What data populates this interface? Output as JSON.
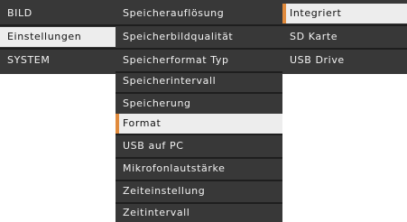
{
  "colors": {
    "panel_bg": "#383838",
    "separator": "#1e1e1e",
    "text": "#f2f2f2",
    "highlight_bg": "#ededed",
    "highlight_text": "#111111",
    "accent": "#e08a3c"
  },
  "main_menu": {
    "items": [
      {
        "label": "BILD"
      },
      {
        "label": "Einstellungen",
        "selected": true
      },
      {
        "label": "SYSTEM"
      }
    ]
  },
  "settings_menu": {
    "items": [
      {
        "label": "Speicherauflösung"
      },
      {
        "label": "Speicherbildqualität"
      },
      {
        "label": "Speicherformat Typ"
      },
      {
        "label": "Speicherintervall"
      },
      {
        "label": "Speicherung"
      },
      {
        "label": "Format",
        "selected": true
      },
      {
        "label": "USB auf PC"
      },
      {
        "label": "Mikrofonlautstärke"
      },
      {
        "label": "Zeiteinstellung"
      },
      {
        "label": "Zeitintervall"
      }
    ]
  },
  "format_menu": {
    "items": [
      {
        "label": "Integriert",
        "selected": true
      },
      {
        "label": "SD Karte"
      },
      {
        "label": "USB Drive"
      }
    ]
  }
}
